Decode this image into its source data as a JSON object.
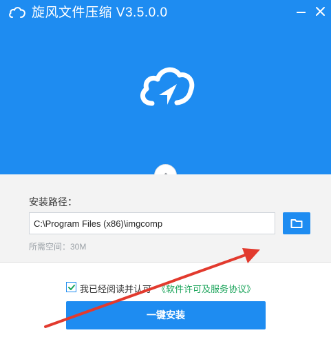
{
  "window": {
    "title": "旋风文件压缩 V3.5.0.0",
    "app_icon": "cloud-icon",
    "minimize_icon": "minimize-icon",
    "close_icon": "close-icon"
  },
  "colors": {
    "brand": "#1e8cf1",
    "link": "#1aa45a",
    "annotation": "#e23a2e"
  },
  "install": {
    "path_label": "安装路径：",
    "path_value": "C:\\Program Files (x86)\\imgcomp",
    "browse_icon": "folder-icon",
    "space_required": "所需空间：30M"
  },
  "agreement": {
    "checked": true,
    "text": "我已经阅读并认可",
    "link_text": "《软件许可及服务协议》"
  },
  "actions": {
    "install_label": "一键安装"
  }
}
